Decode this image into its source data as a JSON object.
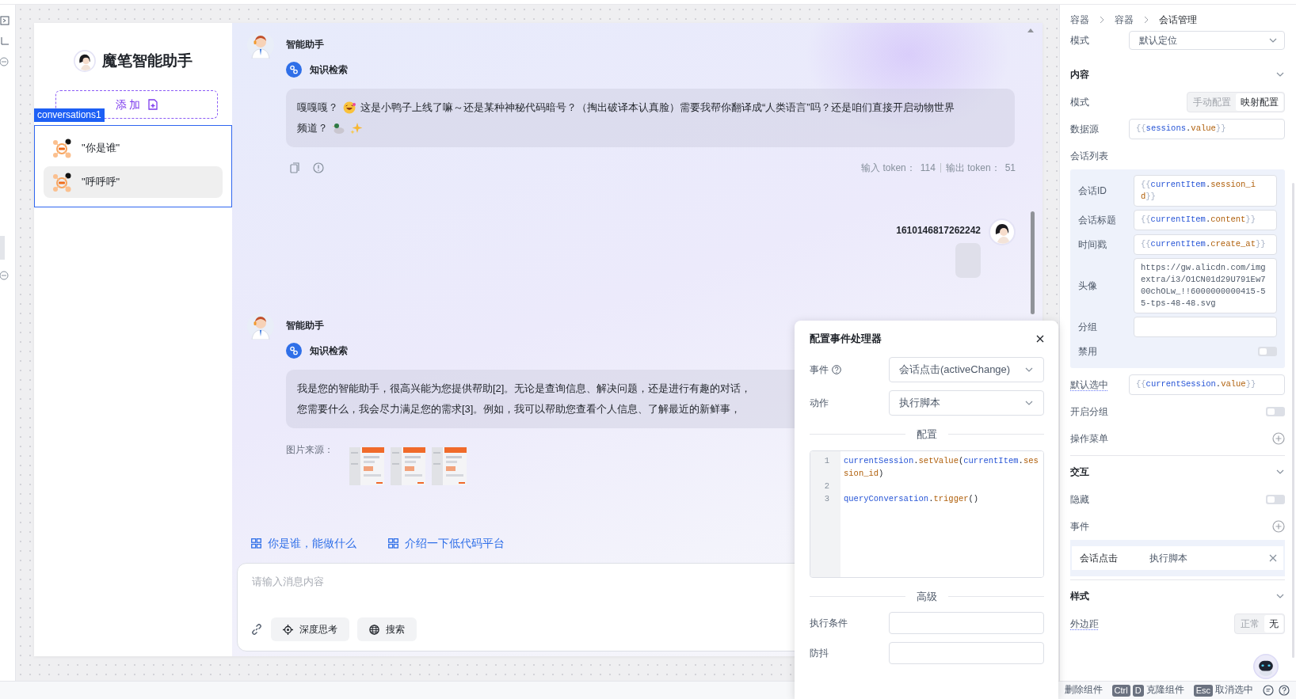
{
  "sidebar": {
    "title": "魔笔智能助手",
    "add_button": "添 加",
    "component_tag": "conversations1",
    "conversations": [
      {
        "title": "\"你是谁\"",
        "selected": false
      },
      {
        "title": "\"呼呼呼\"",
        "selected": true
      }
    ]
  },
  "messages": [
    {
      "kind": "assistant",
      "sender": "智能助手",
      "tool": "知识检索",
      "lines": [
        [
          {
            "kind": "text",
            "text": "嘎嘎嘎？"
          },
          {
            "kind": "laugh"
          },
          {
            "kind": "text",
            "text": "这是小鸭子上线了嘛～还是某种神秘代码暗号？（掏出破译本认真脸）需要我帮你翻译成“人类语言”吗？还是咱们直接开启动物世界"
          }
        ],
        [
          {
            "kind": "text",
            "text": "频道？"
          },
          {
            "kind": "duck"
          },
          {
            "kind": "sparkle"
          }
        ]
      ],
      "tokens": {
        "input_label": "输入 token：",
        "input": "114",
        "output_label": "输出 token：",
        "output": "51"
      }
    },
    {
      "kind": "user",
      "sender": "1610146817262242"
    },
    {
      "kind": "assistant",
      "sender": "智能助手",
      "tool": "知识检索",
      "lines": [
        [
          {
            "kind": "text",
            "text": "我是您的智能助手，很高兴能为您提供帮助[2]。无论是查询信息、解决问题，还是进行有趣的对话，"
          }
        ],
        [
          {
            "kind": "text",
            "text": "您需要什么，我会尽力满足您的需求[3]。例如，我可以帮助您查看个人信息、了解最近的新鲜事，"
          }
        ]
      ],
      "image_source_label": "图片来源：",
      "images": [
        {
          "kind": "picture"
        },
        {
          "kind": "picture"
        },
        {
          "kind": "picture"
        }
      ]
    }
  ],
  "suggestions": [
    {
      "label": "你是谁，能做什么"
    },
    {
      "label": "介绍一下低代码平台"
    }
  ],
  "composer": {
    "placeholder": "请输入消息内容",
    "buttons": [
      {
        "kind": "think",
        "label": "深度思考"
      },
      {
        "kind": "search",
        "label": "搜索"
      }
    ]
  },
  "properties": {
    "breadcrumb": [
      "容器",
      "容器",
      "会话管理"
    ],
    "top_row": {
      "label": "模式",
      "value": "默认定位"
    },
    "sections": [
      {
        "title": "内容",
        "expanded": true,
        "rows": [
          {
            "kind": "segmented",
            "label": "模式",
            "options": [
              {
                "label": "手动配置",
                "selected": false
              },
              {
                "label": "映射配置",
                "selected": true
              }
            ]
          },
          {
            "kind": "expr",
            "label": "数据源",
            "value": "{{sessions.value}}"
          },
          {
            "kind": "group",
            "label": "会话列表",
            "rows": [
              {
                "kind": "expr",
                "label": "会话ID",
                "value": "{{currentItem.session_id}}"
              },
              {
                "kind": "expr",
                "label": "会话标题",
                "value": "{{currentItem.content}}"
              },
              {
                "kind": "expr",
                "label": "时间戳",
                "value": "{{currentItem.create_at}}"
              },
              {
                "kind": "text",
                "label": "头像",
                "value": "https://gw.alicdn.com/imgextra/i3/O1CN01d29U791Ew700chOLw_!!6000000000415-55-tps-48-48.svg"
              },
              {
                "kind": "text",
                "label": "分组"
              },
              {
                "kind": "switch",
                "label": "禁用",
                "on": false
              }
            ]
          },
          {
            "kind": "expr",
            "label": "默认选中",
            "value": "{{currentSession.value}}",
            "hint": true
          },
          {
            "kind": "switch",
            "label": "开启分组",
            "on": false
          },
          {
            "kind": "add",
            "label": "操作菜单"
          }
        ]
      },
      {
        "title": "交互",
        "expanded": true,
        "rows": [
          {
            "kind": "switch",
            "label": "隐藏",
            "on": false
          },
          {
            "kind": "add",
            "label": "事件"
          },
          {
            "kind": "events",
            "events": [
              {
                "event": "会话点击",
                "action": "执行脚本"
              }
            ]
          }
        ]
      },
      {
        "title": "样式",
        "expanded": true,
        "rows": [
          {
            "kind": "segmented",
            "label": "外边距",
            "hint": true,
            "options": [
              {
                "label": "正常",
                "selected": false
              },
              {
                "label": "无",
                "selected": true
              }
            ]
          }
        ]
      }
    ]
  },
  "event_dialog": {
    "title": "配置事件处理器",
    "fields": [
      {
        "label": "事件",
        "help": true,
        "value": "会话点击(activeChange)"
      },
      {
        "label": "动作",
        "help": false,
        "value": "执行脚本"
      }
    ],
    "config_heading": "配置",
    "code": [
      {
        "number": "1",
        "code": "currentSession.setValue(currentItem.session_id)"
      },
      {
        "number": "2"
      },
      {
        "number": "3",
        "code": "queryConversation.trigger()"
      }
    ],
    "advanced_heading": "高级",
    "advanced_fields": [
      {
        "label": "执行条件"
      },
      {
        "label": "防抖"
      }
    ]
  },
  "status_bar": {
    "shortcuts": [
      {
        "label": "删除组件"
      },
      {
        "keys": [
          "Ctrl",
          "D"
        ],
        "label": "克隆组件"
      },
      {
        "keys": [
          "Esc"
        ],
        "label": "取消选中"
      }
    ]
  }
}
